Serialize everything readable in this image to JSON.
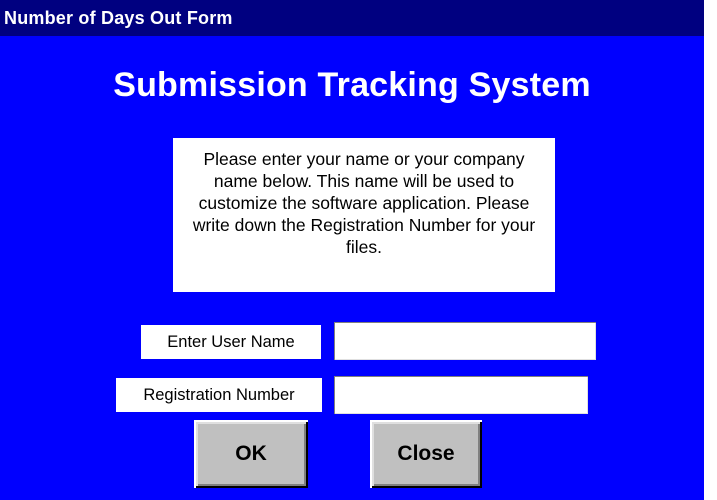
{
  "window": {
    "title": "Number of Days Out Form"
  },
  "app": {
    "heading": "Submission Tracking System"
  },
  "instructions": {
    "text": "Please enter your name or your company name below.  This name will be used to customize the software application.  Please write down the Registration Number for your files."
  },
  "form": {
    "user_name_label": "Enter User Name",
    "user_name_value": "",
    "registration_label": "Registration Number",
    "registration_value": ""
  },
  "buttons": {
    "ok_label": "OK",
    "close_label": "Close"
  },
  "colors": {
    "background": "#0000ff",
    "titlebar": "#000080",
    "button_face": "#c0c0c0"
  }
}
